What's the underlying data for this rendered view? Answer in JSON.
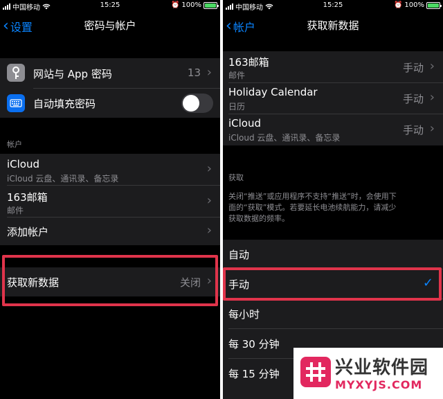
{
  "status": {
    "carrier": "中国移动",
    "time": "15:25",
    "battery": "100%"
  },
  "left": {
    "back_label": "设置",
    "title": "密码与帐户",
    "websites_label": "网站与 App 密码",
    "websites_count": "13",
    "autofill_label": "自动填充密码",
    "autofill_on": false,
    "accounts_header": "帐户",
    "accounts": [
      {
        "title": "iCloud",
        "subtitle": "iCloud 云盘、通讯录、备忘录"
      },
      {
        "title": "163邮箱",
        "subtitle": "邮件"
      }
    ],
    "add_account": "添加帐户",
    "fetch_label": "获取新数据",
    "fetch_value": "关闭"
  },
  "right": {
    "back_label": "帐户",
    "title": "获取新数据",
    "accounts": [
      {
        "title": "163邮箱",
        "subtitle": "邮件",
        "value": "手动"
      },
      {
        "title": "Holiday Calendar",
        "subtitle": "日历",
        "value": "手动"
      },
      {
        "title": "iCloud",
        "subtitle": "iCloud 云盘、通讯录、备忘录",
        "value": "手动"
      }
    ],
    "fetch_header": "获取",
    "fetch_note_line1": "关闭“推送”或应用程序不支持“推送”时，会使用下",
    "fetch_note_line2": "面的“获取”模式。若要延长电池续航能力，请减少",
    "fetch_note_line3": "获取数据的频率。",
    "options": [
      "自动",
      "手动",
      "每小时",
      "每 30 分钟",
      "每 15 分钟"
    ],
    "selected_option": "手动"
  },
  "watermark": {
    "name": "兴业软件园",
    "url": "MYXYJS.COM"
  },
  "colors": {
    "accent": "#0a84ff",
    "highlight": "#e0344b",
    "battery": "#4cd964",
    "watermark": "#e2285f"
  }
}
